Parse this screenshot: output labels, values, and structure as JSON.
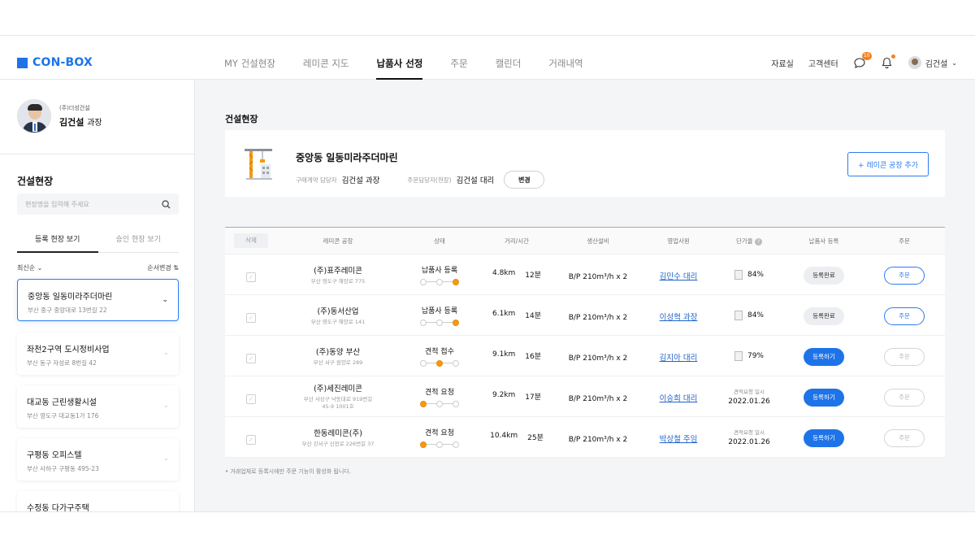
{
  "header": {
    "logo": "CON-BOX",
    "nav": [
      "MY 건설현장",
      "레미콘 지도",
      "납품사 선정",
      "주문",
      "캘린더",
      "거래내역"
    ],
    "active_nav": "납품사 선정",
    "util": {
      "library": "자료실",
      "support": "고객센터",
      "chat_badge": "10",
      "user_name": "김건설"
    }
  },
  "sidebar": {
    "profile": {
      "company": "(주)더성건설",
      "name": "김건설",
      "title": "과장"
    },
    "title": "건설현장",
    "search_placeholder": "현장명을 입력해 주세요",
    "tabs": [
      "등록 현장 보기",
      "승인 현장 보기"
    ],
    "sort": "최신순",
    "sort_edit": "순서변경",
    "sites": [
      {
        "name": "중앙동 일동미라주더마린",
        "addr": "부산 중구 중앙대로 13번길 22",
        "active": true
      },
      {
        "name": "좌천2구역 도시정비사업",
        "addr": "부산 동구 자성로 8번길 42",
        "active": false
      },
      {
        "name": "대교동 근린생활시설",
        "addr": "부산 영도구 대교동1가 176",
        "active": false
      },
      {
        "name": "구평동 오피스텔",
        "addr": "부산 사하구 구평동 495-23",
        "active": false
      },
      {
        "name": "수정동 다가구주택",
        "addr": "",
        "active": false
      }
    ]
  },
  "main": {
    "title": "건설현장",
    "site": {
      "name": "중앙동 일동미라주더마린",
      "contract_label": "구매계약 담당자",
      "contract_name": "김건설 과장",
      "order_label": "주문담당자(현장)",
      "order_name": "김건설 대리",
      "change_btn": "변경",
      "add_btn": "+ 레미콘 공장 추가"
    },
    "table": {
      "delete_btn": "삭제",
      "headers": [
        "레미콘 공장",
        "상태",
        "거리/시간",
        "생산설비",
        "영업사원",
        "단가율",
        "납품사 등록",
        "주문"
      ],
      "rows": [
        {
          "plant": "(주)표주레미콘",
          "addr1": "부산 영도구 해양로 775",
          "addr2": "",
          "status": "납품사 등록",
          "step": 3,
          "dist": "4.8km",
          "time": "12분",
          "spec": "B/P 210m³/h x 2",
          "rep": "김민수 대리",
          "rate": "84%",
          "date_lbl": "",
          "date": "",
          "reg": "등록완료",
          "reg_type": "done",
          "order": "주문",
          "order_enabled": true
        },
        {
          "plant": "(주)동서산업",
          "addr1": "부산 영도구 해양로 141",
          "addr2": "",
          "status": "납품사 등록",
          "step": 3,
          "dist": "6.1km",
          "time": "14분",
          "spec": "B/P 210m³/h x 2",
          "rep": "이성혁 과장",
          "rate": "84%",
          "date_lbl": "",
          "date": "",
          "reg": "등록완료",
          "reg_type": "done",
          "order": "주문",
          "order_enabled": true
        },
        {
          "plant": "(주)동양 부산",
          "addr1": "부산 서구 원양로 289",
          "addr2": "",
          "status": "견적 접수",
          "step": 2,
          "dist": "9.1km",
          "time": "16분",
          "spec": "B/P 210m³/h x 2",
          "rep": "김지아 대리",
          "rate": "79%",
          "date_lbl": "",
          "date": "",
          "reg": "등록하기",
          "reg_type": "register",
          "order": "주문",
          "order_enabled": false
        },
        {
          "plant": "(주)세진레미콘",
          "addr1": "부산 사상구 낙동대로 919번길",
          "addr2": "45-9 1001호",
          "status": "견적 요청",
          "step": 1,
          "dist": "9.2km",
          "time": "17분",
          "spec": "B/P 210m³/h x 2",
          "rep": "이승희 대리",
          "rate": "",
          "date_lbl": "견적요청 일시",
          "date": "2022.01.26",
          "reg": "등록하기",
          "reg_type": "register",
          "order": "주문",
          "order_enabled": false
        },
        {
          "plant": "한동레미콘(주)",
          "addr1": "부산 강서구 신전로 226번길 37",
          "addr2": "",
          "status": "견적 요청",
          "step": 1,
          "dist": "10.4km",
          "time": "25분",
          "spec": "B/P 210m³/h x 2",
          "rep": "박상철 주임",
          "rate": "",
          "date_lbl": "견적요청 일시",
          "date": "2022.01.26",
          "reg": "등록하기",
          "reg_type": "register",
          "order": "주문",
          "order_enabled": false
        }
      ]
    },
    "footnote": "• 거래업체로 등록시에만 주문 기능이 활성화 됩니다."
  }
}
